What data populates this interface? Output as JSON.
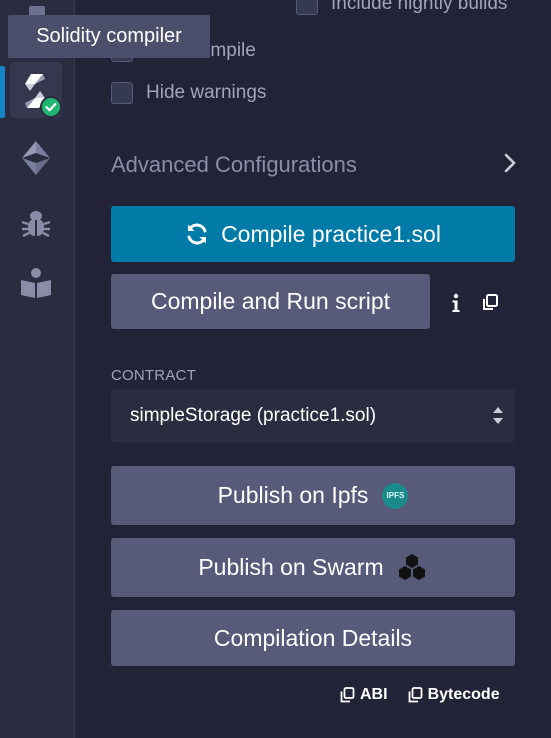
{
  "tooltip": {
    "text": "Solidity compiler"
  },
  "options": {
    "nightly_label": "Include nightly builds",
    "auto_compile_label": "Auto compile",
    "hide_warnings_label": "Hide warnings"
  },
  "advanced": {
    "label": "Advanced Configurations"
  },
  "compile": {
    "label": "Compile practice1.sol"
  },
  "script": {
    "label": "Compile and Run script"
  },
  "contract": {
    "label": "CONTRACT",
    "selected": "simpleStorage (practice1.sol)"
  },
  "publish": {
    "ipfs_label": "Publish on Ipfs",
    "ipfs_badge": "IPFS",
    "swarm_label": "Publish on Swarm"
  },
  "details": {
    "label": "Compilation Details"
  },
  "links": {
    "abi": "ABI",
    "bytecode": "Bytecode"
  },
  "colors": {
    "accent": "#007aa6",
    "success": "#21b573",
    "panel": "#222336",
    "rail": "#2a2c3f",
    "button": "#585a7a"
  }
}
